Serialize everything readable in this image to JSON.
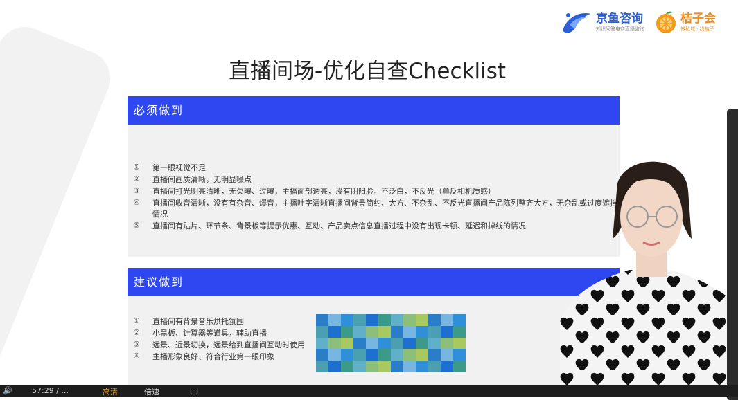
{
  "logos": {
    "jingyu": {
      "name": "京鱼咨询",
      "tagline": "知识问答电商直播咨询",
      "color": "#2d5fd6"
    },
    "juzi": {
      "name": "桔子会",
      "tagline": "做私域 · 找桔子",
      "color": "#f08a14"
    }
  },
  "title": "直播间场-优化自查Checklist",
  "must": {
    "header": "必须做到",
    "items": [
      {
        "num": "①",
        "text": "第一眼视觉不足"
      },
      {
        "num": "②",
        "text": "直播间画质清晰，无明显噪点"
      },
      {
        "num": "③",
        "text": "直播间打光明亮清晰，无欠曝、过曝，主播面部透亮，没有阴阳脸。不泛白，不反光（单反相机质感）"
      },
      {
        "num": "④",
        "text": "直播间收音清晰，没有有杂音、爆音，主播吐字清晰直播间背景简约、大方、不杂乱、不反光直播间产品陈列整齐大方，无杂乱或过度遮挡情况"
      },
      {
        "num": "⑤",
        "text": "直播间有贴片、环节条、背景板等提示优惠、互动、产品卖点信息直播过程中没有出现卡顿、延迟和掉线的情况"
      }
    ]
  },
  "suggest": {
    "header": "建议做到",
    "items": [
      {
        "num": "①",
        "text": "直播间有背景音乐烘托氛围"
      },
      {
        "num": "②",
        "text": "小黑板、计算器等道具，辅助直播"
      },
      {
        "num": "③",
        "text": "远景、近景切换，远景给到直播间互动时使用"
      },
      {
        "num": "④",
        "text": "主播形象良好、符合行业第一眼印象"
      }
    ]
  },
  "player": {
    "time": "57:29 / ...",
    "mode_label": "高清",
    "speed_label": "倍速",
    "fullscreen_icon": "fullscreen-icon",
    "volume_icon": "volume-icon",
    "accent": "#f0a020"
  }
}
